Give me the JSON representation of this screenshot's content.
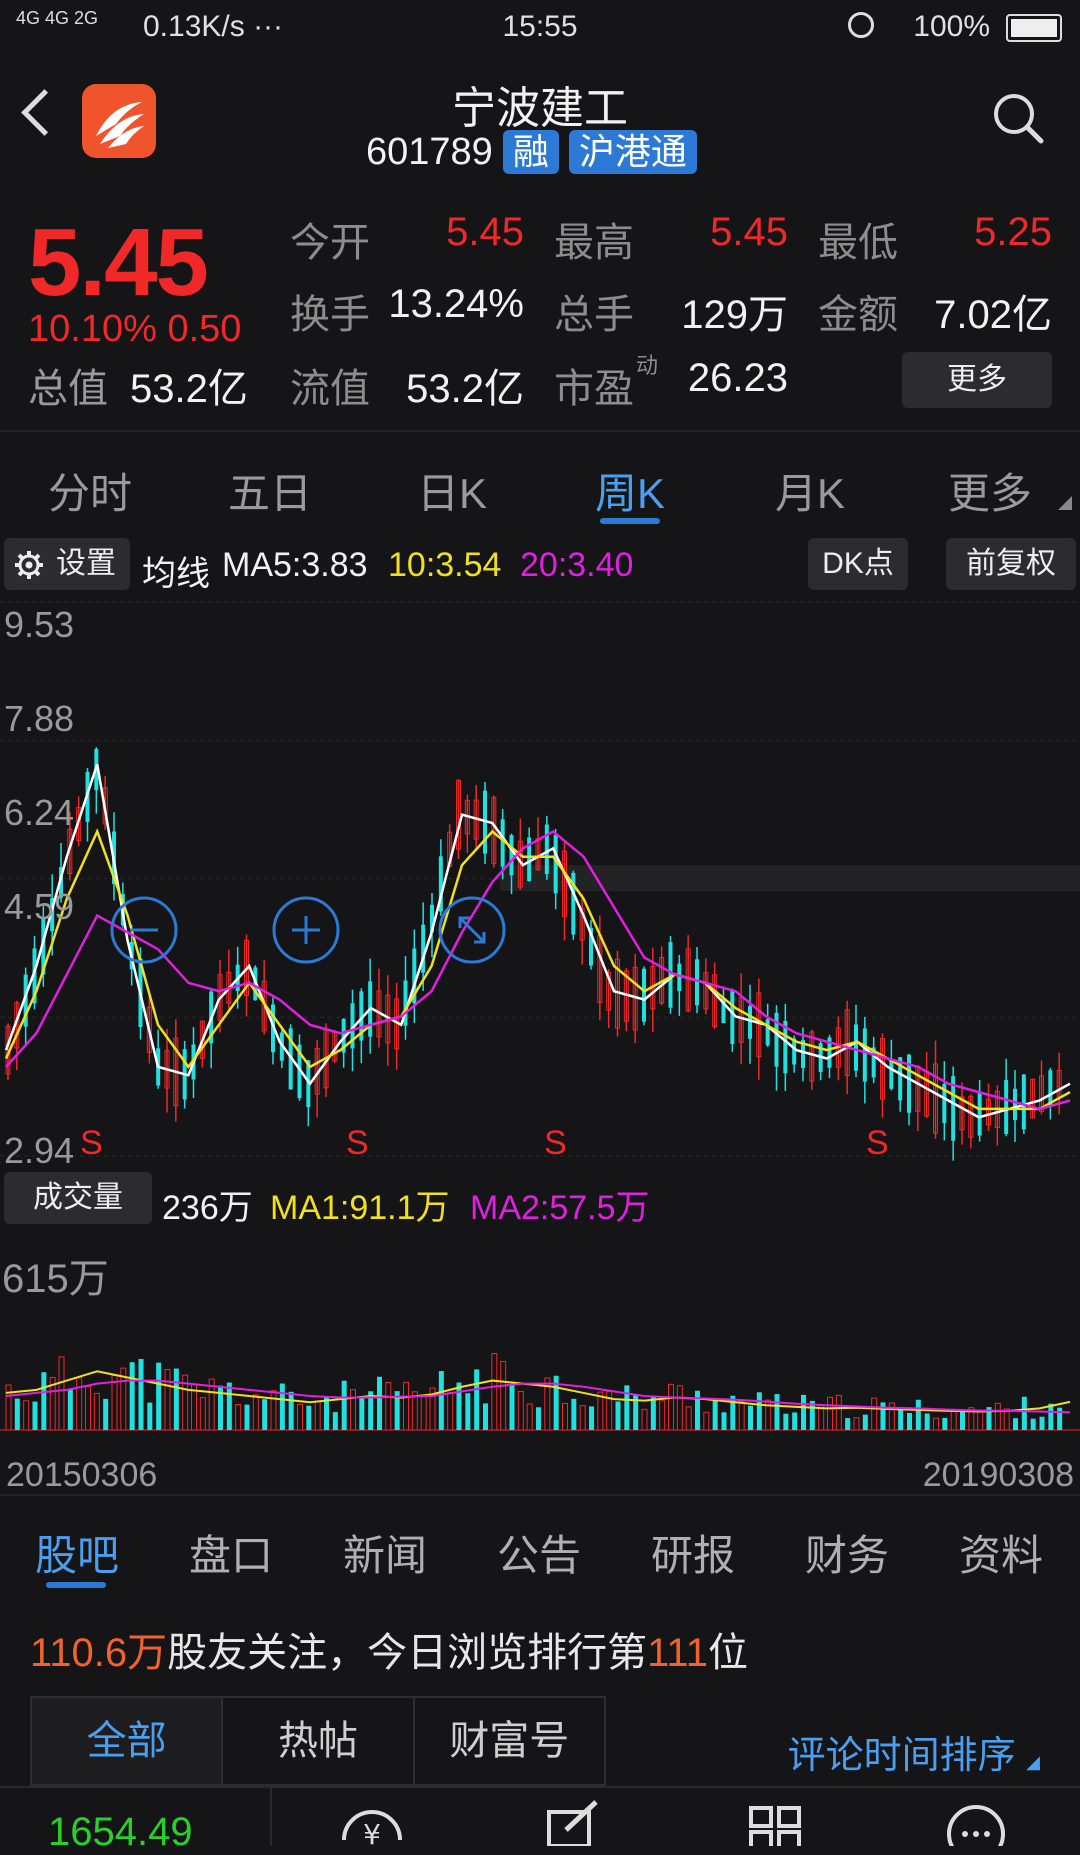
{
  "status_bar": {
    "network": "4G 4G 2G",
    "speed": "0.13K/s ···",
    "time": "15:55",
    "battery": "100%"
  },
  "header": {
    "name": "宁波建工",
    "code": "601789",
    "tags": [
      "融",
      "沪港通"
    ]
  },
  "quote": {
    "price": "5.45",
    "change_pct": "10.10%",
    "change": "0.50",
    "market_value_label": "总值",
    "market_value": "53.2亿",
    "rows": [
      [
        {
          "label": "今开",
          "value": "5.45"
        },
        {
          "label": "最高",
          "value": "5.45"
        },
        {
          "label": "最低",
          "value": "5.25"
        }
      ],
      [
        {
          "label": "换手",
          "value": "13.24%"
        },
        {
          "label": "总手",
          "value": "129万"
        },
        {
          "label": "金额",
          "value": "7.02亿"
        }
      ],
      [
        {
          "label": "流值",
          "value": "53.2亿"
        },
        {
          "label": "市盈",
          "value": "26.23"
        }
      ]
    ],
    "pe_superscript": "动",
    "more_label": "更多"
  },
  "chart_tabs": [
    "分时",
    "五日",
    "日K",
    "周K",
    "月K",
    "更多"
  ],
  "chart_tabs_active": "周K",
  "ma_row": {
    "settings_label": "设置",
    "title": "均线",
    "ma5": "MA5:3.83",
    "ma10": "10:3.54",
    "ma20": "20:3.40",
    "dk_label": "DK点",
    "adjust_label": "前复权"
  },
  "chart_data": {
    "type": "line",
    "title": "",
    "ylim": [
      2.94,
      9.53
    ],
    "yticks": [
      "9.53",
      "7.88",
      "6.24",
      "4.59",
      "2.94"
    ],
    "x_start": "20150306",
    "x_end": "20190308",
    "markers": [
      "S",
      "S",
      "S",
      "S"
    ],
    "series": [
      {
        "name": "MA5",
        "values": [
          4.2,
          5.2,
          6.5,
          7.6,
          5.5,
          4.0,
          3.9,
          4.8,
          5.2,
          4.3,
          3.8,
          4.3,
          4.7,
          4.5,
          5.6,
          7.0,
          6.9,
          6.4,
          6.6,
          5.8,
          4.9,
          4.8,
          5.1,
          5.0,
          4.6,
          4.5,
          4.2,
          4.1,
          4.3,
          4.0,
          3.8,
          3.6,
          3.4,
          3.5,
          3.6,
          3.8
        ]
      },
      {
        "name": "10",
        "values": [
          4.1,
          4.9,
          6.0,
          6.8,
          5.8,
          4.5,
          4.0,
          4.5,
          5.0,
          4.5,
          4.0,
          4.2,
          4.5,
          4.6,
          5.2,
          6.4,
          6.8,
          6.5,
          6.5,
          6.0,
          5.2,
          4.9,
          5.1,
          5.0,
          4.7,
          4.5,
          4.3,
          4.2,
          4.3,
          4.1,
          3.9,
          3.7,
          3.5,
          3.5,
          3.5,
          3.7
        ]
      },
      {
        "name": "20",
        "values": [
          4.0,
          4.4,
          5.1,
          5.8,
          5.6,
          5.4,
          5.0,
          4.9,
          5.0,
          4.8,
          4.5,
          4.4,
          4.5,
          4.6,
          4.9,
          5.6,
          6.2,
          6.6,
          6.8,
          6.5,
          5.9,
          5.3,
          5.1,
          5.0,
          4.9,
          4.6,
          4.4,
          4.3,
          4.2,
          4.1,
          4.0,
          3.8,
          3.7,
          3.6,
          3.5,
          3.6
        ]
      }
    ]
  },
  "volume": {
    "label": "成交量",
    "value": "236万",
    "ma1": "MA1:91.1万",
    "ma2": "MA2:57.5万",
    "max_label": "615万",
    "ma1_values": [
      120,
      130,
      160,
      190,
      170,
      150,
      130,
      120,
      110,
      100,
      90,
      100,
      110,
      105,
      115,
      140,
      160,
      150,
      140,
      120,
      100,
      95,
      105,
      100,
      90,
      80,
      75,
      70,
      72,
      68,
      65,
      62,
      60,
      62,
      70,
      91
    ],
    "ma2_values": [
      110,
      120,
      130,
      150,
      160,
      160,
      150,
      140,
      130,
      120,
      110,
      105,
      105,
      108,
      110,
      125,
      140,
      150,
      150,
      140,
      125,
      110,
      105,
      102,
      98,
      92,
      85,
      80,
      76,
      72,
      70,
      66,
      63,
      62,
      60,
      57
    ]
  },
  "dates": {
    "start": "20150306",
    "end": "20190308"
  },
  "bottom_tabs": [
    "股吧",
    "盘口",
    "新闻",
    "公告",
    "研报",
    "财务",
    "资料"
  ],
  "bottom_tabs_active": "股吧",
  "follow": {
    "count": "110.6万",
    "text1": "股友关注，今日浏览排行第",
    "rank": "111",
    "text2": "位"
  },
  "filter_tabs": [
    "全部",
    "热帖",
    "财富号"
  ],
  "filter_active": "全部",
  "sort_label": "评论时间排序",
  "index_value": "1654.49",
  "colors": {
    "up": "#f02828",
    "down": "#20e0e0",
    "ma5": "#ffffff",
    "ma10": "#f0e020",
    "ma20": "#e020e0",
    "accent": "#2c7ad6"
  }
}
